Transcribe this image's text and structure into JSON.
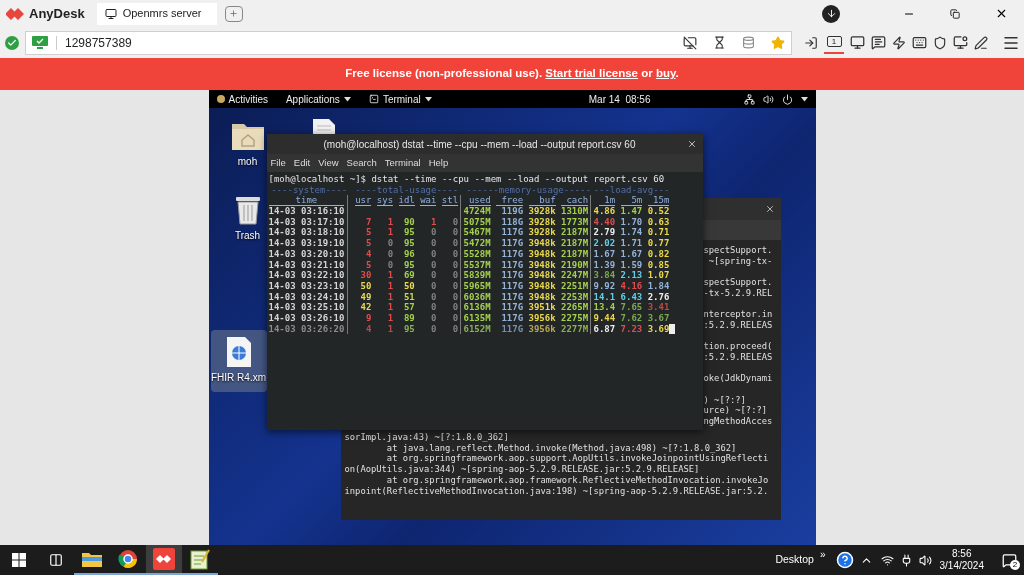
{
  "app": {
    "name": "AnyDesk"
  },
  "tabs": [
    {
      "label": "Openmrs server",
      "selected": true
    }
  ],
  "address": {
    "value": "1298757389"
  },
  "display_button": {
    "label": "1",
    "selected": true
  },
  "banner": {
    "parts": [
      {
        "kind": "text",
        "text": "Free license (non-professional use). "
      },
      {
        "kind": "link",
        "text": "Start trial license"
      },
      {
        "kind": "text",
        "text": " or "
      },
      {
        "kind": "link",
        "text": "buy"
      },
      {
        "kind": "text",
        "text": "."
      }
    ]
  },
  "remote_topbar": {
    "activities": "Activities",
    "menus": [
      {
        "label": "Applications",
        "kind": "plain"
      },
      {
        "label": "Terminal",
        "kind": "terminal"
      }
    ],
    "clock": "Mar 14  08:56"
  },
  "desktop_icons": [
    {
      "kind": "folder",
      "label": "moh",
      "selected": false
    },
    {
      "kind": "document",
      "selected": false
    },
    {
      "kind": "trash",
      "label": "Trash",
      "selected": false
    },
    {
      "kind": "web-file",
      "label": "FHIR R4.xm",
      "selected": true
    }
  ],
  "back_terminal": {
    "strip_groups": [
      [
        "spectSupport.",
        " ~[spring-tx-"
      ],
      [
        "spectSupport.",
        "-tx-5.2.9.REL"
      ],
      [
        "nterceptor.in",
        ":5.2.9.RELEAS"
      ],
      [
        "tion.proceed(",
        ":5.2.9.RELEAS"
      ],
      [
        "oke(JdkDynami"
      ],
      [
        ") ~[?:?]",
        "urce) ~[?:?]",
        "ngMethodAcces"
      ]
    ],
    "lines": [
      {
        "text": "sorImpl.java:43) ~[?:1.8.0_362]",
        "indent": false
      },
      {
        "text": "at java.lang.reflect.Method.invoke(Method.java:498) ~[?:1.8.0_362]",
        "indent": true
      },
      {
        "text": "at org.springframework.aop.support.AopUtils.invokeJoinpointUsingReflecti",
        "indent": true
      },
      {
        "text": "on(AopUtils.java:344) ~[spring-aop-5.2.9.RELEASE.jar:5.2.9.RELEASE]",
        "indent": false
      },
      {
        "text": "at org.springframework.aop.framework.ReflectiveMethodInvocation.invokeJo",
        "indent": true
      },
      {
        "text": "inpoint(ReflectiveMethodInvocation.java:198) ~[spring-aop-5.2.9.RELEASE.jar:5.2.",
        "indent": false
      }
    ]
  },
  "terminal": {
    "title": "(moh@localhost) dstat --time --cpu --mem --load --output report.csv 60",
    "menu": [
      "File",
      "Edit",
      "View",
      "Search",
      "Terminal",
      "Help"
    ],
    "prompt": "[moh@localhost ~]$ dstat --time --cpu --mem --load --output report.csv 60",
    "groups": [
      "----system----",
      "----total-usage----",
      "------memory-usage-----",
      "---load-avg---"
    ],
    "columns": [
      "time",
      "usr",
      "sys",
      "idl",
      "wai",
      "stl",
      "used",
      "free",
      "buf",
      "cach",
      "1m",
      "5m",
      "15m"
    ],
    "rows": [
      {
        "cells": [
          {
            "text": "14-03 03:16:10",
            "color": "#d6d6d6"
          },
          {
            "text": ""
          },
          {
            "text": ""
          },
          {
            "text": ""
          },
          {
            "text": ""
          },
          {
            "text": ""
          },
          {
            "text": "4724M",
            "color": "#a3d14a"
          },
          {
            "text": "119G",
            "color": "#94b3db"
          },
          {
            "text": "3928k",
            "color": "#ead94c"
          },
          {
            "text": "1310M",
            "color": "#a3d14a"
          },
          {
            "text": "4.86",
            "color": "#ead94c"
          },
          {
            "text": "1.47",
            "color": "#a3d14a"
          },
          {
            "text": "0.52",
            "color": "#ead94c"
          }
        ]
      },
      {
        "cells": [
          {
            "text": "14-03 03:17:10",
            "color": "#d6d6d6"
          },
          {
            "text": "7",
            "color": "#e34b4b"
          },
          {
            "text": "1",
            "color": "#e34b4b"
          },
          {
            "text": "90",
            "color": "#a3d14a"
          },
          {
            "text": "1",
            "color": "#e34b4b"
          },
          {
            "text": "0",
            "color": "#808080"
          },
          {
            "text": "5075M",
            "color": "#a3d14a"
          },
          {
            "text": "118G",
            "color": "#94b3db"
          },
          {
            "text": "3928k",
            "color": "#ead94c"
          },
          {
            "text": "1773M",
            "color": "#a3d14a"
          },
          {
            "text": "4.40",
            "color": "#e34b4b"
          },
          {
            "text": "1.70",
            "color": "#94b3db"
          },
          {
            "text": "0.63",
            "color": "#ead94c"
          }
        ]
      },
      {
        "cells": [
          {
            "text": "14-03 03:18:10",
            "color": "#d6d6d6"
          },
          {
            "text": "5",
            "color": "#e34b4b"
          },
          {
            "text": "1",
            "color": "#e34b4b"
          },
          {
            "text": "95",
            "color": "#a3d14a"
          },
          {
            "text": "0",
            "color": "#808080"
          },
          {
            "text": "0",
            "color": "#808080"
          },
          {
            "text": "5467M",
            "color": "#a3d14a"
          },
          {
            "text": "117G",
            "color": "#94b3db"
          },
          {
            "text": "3928k",
            "color": "#ead94c"
          },
          {
            "text": "2187M",
            "color": "#a3d14a"
          },
          {
            "text": "2.79",
            "color": "#eeeeee"
          },
          {
            "text": "1.74",
            "color": "#94b3db"
          },
          {
            "text": "0.71",
            "color": "#ead94c"
          }
        ]
      },
      {
        "cells": [
          {
            "text": "14-03 03:19:10",
            "color": "#d6d6d6"
          },
          {
            "text": "5",
            "color": "#e34b4b"
          },
          {
            "text": "0",
            "color": "#808080"
          },
          {
            "text": "95",
            "color": "#a3d14a"
          },
          {
            "text": "0",
            "color": "#808080"
          },
          {
            "text": "0",
            "color": "#808080"
          },
          {
            "text": "5472M",
            "color": "#a3d14a"
          },
          {
            "text": "117G",
            "color": "#94b3db"
          },
          {
            "text": "3948k",
            "color": "#ead94c"
          },
          {
            "text": "2187M",
            "color": "#a3d14a"
          },
          {
            "text": "2.02",
            "color": "#5fd0e8"
          },
          {
            "text": "1.71",
            "color": "#94b3db"
          },
          {
            "text": "0.77",
            "color": "#ead94c"
          }
        ]
      },
      {
        "cells": [
          {
            "text": "14-03 03:20:10",
            "color": "#d6d6d6"
          },
          {
            "text": "4",
            "color": "#e34b4b"
          },
          {
            "text": "0",
            "color": "#808080"
          },
          {
            "text": "96",
            "color": "#a3d14a"
          },
          {
            "text": "0",
            "color": "#808080"
          },
          {
            "text": "0",
            "color": "#808080"
          },
          {
            "text": "5528M",
            "color": "#a3d14a"
          },
          {
            "text": "117G",
            "color": "#94b3db"
          },
          {
            "text": "3948k",
            "color": "#ead94c"
          },
          {
            "text": "2187M",
            "color": "#a3d14a"
          },
          {
            "text": "1.67",
            "color": "#94b3db"
          },
          {
            "text": "1.67",
            "color": "#94b3db"
          },
          {
            "text": "0.82",
            "color": "#ead94c"
          }
        ]
      },
      {
        "cells": [
          {
            "text": "14-03 03:21:10",
            "color": "#d6d6d6"
          },
          {
            "text": "5",
            "color": "#e34b4b"
          },
          {
            "text": "0",
            "color": "#808080"
          },
          {
            "text": "95",
            "color": "#a3d14a"
          },
          {
            "text": "0",
            "color": "#808080"
          },
          {
            "text": "0",
            "color": "#808080"
          },
          {
            "text": "5537M",
            "color": "#a3d14a"
          },
          {
            "text": "117G",
            "color": "#94b3db"
          },
          {
            "text": "3948k",
            "color": "#ead94c"
          },
          {
            "text": "2190M",
            "color": "#a3d14a"
          },
          {
            "text": "1.39",
            "color": "#94b3db"
          },
          {
            "text": "1.59",
            "color": "#94b3db"
          },
          {
            "text": "0.85",
            "color": "#ead94c"
          }
        ]
      },
      {
        "cells": [
          {
            "text": "14-03 03:22:10",
            "color": "#d6d6d6"
          },
          {
            "text": "30",
            "color": "#e34b4b"
          },
          {
            "text": "1",
            "color": "#e34b4b"
          },
          {
            "text": "69",
            "color": "#a3d14a"
          },
          {
            "text": "0",
            "color": "#808080"
          },
          {
            "text": "0",
            "color": "#808080"
          },
          {
            "text": "5839M",
            "color": "#a3d14a"
          },
          {
            "text": "117G",
            "color": "#94b3db"
          },
          {
            "text": "3948k",
            "color": "#ead94c"
          },
          {
            "text": "2247M",
            "color": "#a3d14a"
          },
          {
            "text": "3.84",
            "color": "#7aaa50"
          },
          {
            "text": "2.13",
            "color": "#5fd0e8"
          },
          {
            "text": "1.07",
            "color": "#ead94c"
          }
        ]
      },
      {
        "cells": [
          {
            "text": "14-03 03:23:10",
            "color": "#d6d6d6"
          },
          {
            "text": "50",
            "color": "#ead94c"
          },
          {
            "text": "1",
            "color": "#e34b4b"
          },
          {
            "text": "50",
            "color": "#ead94c"
          },
          {
            "text": "0",
            "color": "#808080"
          },
          {
            "text": "0",
            "color": "#808080"
          },
          {
            "text": "5965M",
            "color": "#a3d14a"
          },
          {
            "text": "117G",
            "color": "#94b3db"
          },
          {
            "text": "3948k",
            "color": "#ead94c"
          },
          {
            "text": "2251M",
            "color": "#a3d14a"
          },
          {
            "text": "9.92",
            "color": "#94b3db"
          },
          {
            "text": "4.16",
            "color": "#e34b4b"
          },
          {
            "text": "1.84",
            "color": "#94b3db"
          }
        ]
      },
      {
        "cells": [
          {
            "text": "14-03 03:24:10",
            "color": "#d6d6d6"
          },
          {
            "text": "49",
            "color": "#ead94c"
          },
          {
            "text": "1",
            "color": "#e34b4b"
          },
          {
            "text": "51",
            "color": "#c8d84a"
          },
          {
            "text": "0",
            "color": "#808080"
          },
          {
            "text": "0",
            "color": "#808080"
          },
          {
            "text": "6036M",
            "color": "#a3d14a"
          },
          {
            "text": "117G",
            "color": "#94b3db"
          },
          {
            "text": "3948k",
            "color": "#ead94c"
          },
          {
            "text": "2253M",
            "color": "#a3d14a"
          },
          {
            "text": "14.1",
            "color": "#5fd0e8"
          },
          {
            "text": "6.43",
            "color": "#5fd0e8"
          },
          {
            "text": "2.76",
            "color": "#eeeeee"
          }
        ]
      },
      {
        "cells": [
          {
            "text": "14-03 03:25:10",
            "color": "#d6d6d6"
          },
          {
            "text": "42",
            "color": "#ead94c"
          },
          {
            "text": "1",
            "color": "#e34b4b"
          },
          {
            "text": "57",
            "color": "#a3d14a"
          },
          {
            "text": "0",
            "color": "#808080"
          },
          {
            "text": "0",
            "color": "#808080"
          },
          {
            "text": "6136M",
            "color": "#a3d14a"
          },
          {
            "text": "117G",
            "color": "#94b3db"
          },
          {
            "text": "3951k",
            "color": "#ead94c"
          },
          {
            "text": "2265M",
            "color": "#a3d14a"
          },
          {
            "text": "13.4",
            "color": "#a3d14a"
          },
          {
            "text": "7.65",
            "color": "#7aaa50"
          },
          {
            "text": "3.41",
            "color": "#c04848"
          }
        ]
      },
      {
        "cells": [
          {
            "text": "14-03 03:26:10",
            "color": "#d6d6d6"
          },
          {
            "text": "9",
            "color": "#e34b4b"
          },
          {
            "text": "1",
            "color": "#e34b4b"
          },
          {
            "text": "89",
            "color": "#a3d14a"
          },
          {
            "text": "0",
            "color": "#808080"
          },
          {
            "text": "0",
            "color": "#808080"
          },
          {
            "text": "6135M",
            "color": "#a3d14a"
          },
          {
            "text": "117G",
            "color": "#94b3db"
          },
          {
            "text": "3956k",
            "color": "#ead94c"
          },
          {
            "text": "2275M",
            "color": "#a3d14a"
          },
          {
            "text": "9.44",
            "color": "#ead94c"
          },
          {
            "text": "7.62",
            "color": "#7aaa50"
          },
          {
            "text": "3.67",
            "color": "#7aaa50"
          }
        ]
      },
      {
        "cells": [
          {
            "text": "14-03 03:26:20",
            "color": "#8c8c8c"
          },
          {
            "text": "4",
            "color": "#c04848"
          },
          {
            "text": "1",
            "color": "#c04848"
          },
          {
            "text": "95",
            "color": "#8ab050"
          },
          {
            "text": "0",
            "color": "#808080"
          },
          {
            "text": "0",
            "color": "#808080"
          },
          {
            "text": "6152M",
            "color": "#8ab050"
          },
          {
            "text": "117G",
            "color": "#7890b4"
          },
          {
            "text": "3956k",
            "color": "#b8a850"
          },
          {
            "text": "2277M",
            "color": "#8ab050"
          },
          {
            "text": "6.87",
            "color": "#eeeeee"
          },
          {
            "text": "7.23",
            "color": "#e34b4b"
          },
          {
            "text": "3.69",
            "color": "#ead94c"
          }
        ]
      }
    ],
    "cursor": true
  },
  "taskbar": {
    "apps": [
      {
        "kind": "explorer",
        "selected": false
      },
      {
        "kind": "chrome",
        "selected": false
      },
      {
        "kind": "anydesk",
        "selected": true
      },
      {
        "kind": "editor",
        "selected": false
      }
    ],
    "desktop_label": "Desktop",
    "chevron": "»",
    "time": "8:56",
    "date": "3/14/2024",
    "notifications": "2"
  }
}
